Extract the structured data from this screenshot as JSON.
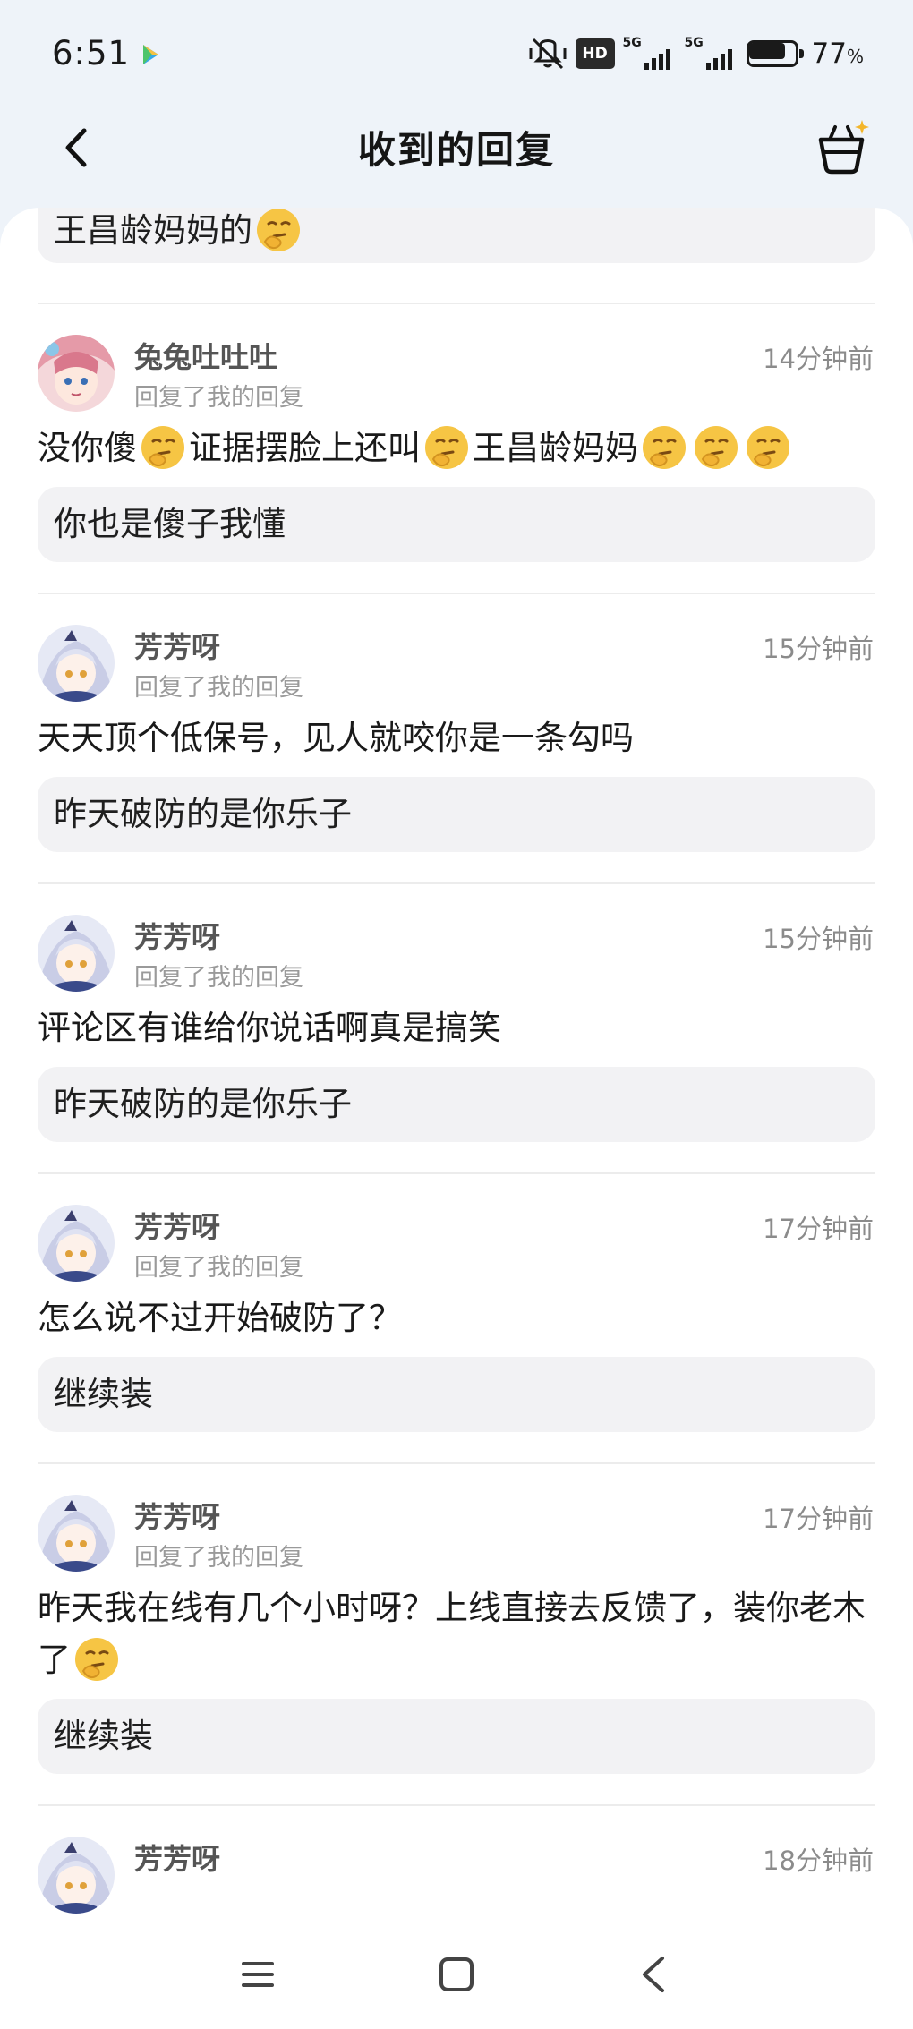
{
  "status_bar": {
    "time": "6:51",
    "network_1": "5G",
    "network_2": "5G",
    "hd_label": "HD",
    "battery_percent": "77",
    "battery_unit": "%",
    "battery_level": 0.77
  },
  "header": {
    "title": "收到的回复"
  },
  "top_partial": {
    "reply_text": "王昌龄妈妈的"
  },
  "notifications": [
    {
      "username": "兔兔吐吐吐",
      "action": "回复了我的回复",
      "time": "14分钟前",
      "avatar": "pink-hair-character-avatar",
      "comment_parts": [
        "没你傻",
        "证据摆脸上还叫",
        "王昌龄妈妈",
        ""
      ],
      "my_reply": "你也是傻子我懂"
    },
    {
      "username": "芳芳呀",
      "action": "回复了我的回复",
      "time": "15分钟前",
      "avatar": "silver-hair-character-avatar",
      "comment_parts": [
        "天天顶个低保号，见人就咬你是一条勾吗"
      ],
      "my_reply": "昨天破防的是你乐子"
    },
    {
      "username": "芳芳呀",
      "action": "回复了我的回复",
      "time": "15分钟前",
      "avatar": "silver-hair-character-avatar",
      "comment_parts": [
        "评论区有谁给你说话啊真是搞笑"
      ],
      "my_reply": "昨天破防的是你乐子"
    },
    {
      "username": "芳芳呀",
      "action": "回复了我的回复",
      "time": "17分钟前",
      "avatar": "silver-hair-character-avatar",
      "comment_parts": [
        "怎么说不过开始破防了？"
      ],
      "my_reply": "继续装"
    },
    {
      "username": "芳芳呀",
      "action": "回复了我的回复",
      "time": "17分钟前",
      "avatar": "silver-hair-character-avatar",
      "comment_parts": [
        "昨天我在线有几个小时呀？上线直接去反馈了，装你老木了"
      ],
      "my_reply": "继续装"
    },
    {
      "username": "芳芳呀",
      "action": "",
      "time": "18分钟前",
      "avatar": "silver-hair-character-avatar",
      "comment_parts": [],
      "my_reply": ""
    }
  ],
  "colors": {
    "background": "#eef3f9",
    "card": "#ffffff",
    "reply_box": "#f2f2f4",
    "emoji": "#f6c544"
  },
  "icons": {
    "back": "back-arrow-icon",
    "cart": "basket-sparkle-icon",
    "emoji": "thinking-face-emoji",
    "nav_menu": "menu-lines-icon",
    "nav_home": "square-home-icon",
    "nav_back": "triangle-back-icon"
  }
}
